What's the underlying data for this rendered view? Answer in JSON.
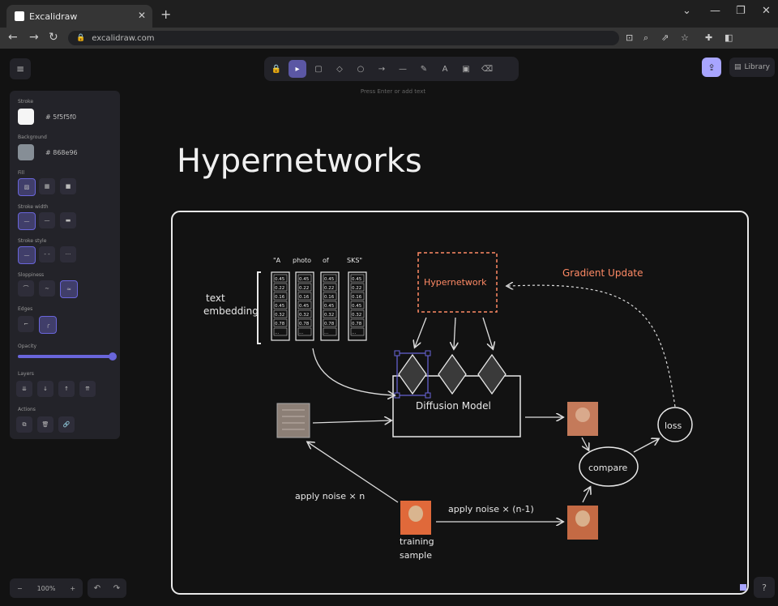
{
  "browser": {
    "tab_title": "Excalidraw",
    "url": "excalidraw.com",
    "new_tab": "+",
    "tab_close": "✕",
    "controls": [
      "⌄",
      "—",
      "❐",
      "✕"
    ],
    "nav": [
      "←",
      "→",
      "↻"
    ]
  },
  "toolbar": {
    "menu_icon": "≡",
    "tools": [
      {
        "name": "lock-icon",
        "glyph": "🔒"
      },
      {
        "name": "selection-icon",
        "glyph": "▸",
        "active": true
      },
      {
        "name": "rectangle-icon",
        "glyph": "▢"
      },
      {
        "name": "diamond-icon",
        "glyph": "◇"
      },
      {
        "name": "ellipse-icon",
        "glyph": "○"
      },
      {
        "name": "arrow-icon",
        "glyph": "→"
      },
      {
        "name": "line-icon",
        "glyph": "—"
      },
      {
        "name": "pencil-icon",
        "glyph": "✎"
      },
      {
        "name": "text-icon",
        "glyph": "A"
      },
      {
        "name": "image-icon",
        "glyph": "▣"
      },
      {
        "name": "eraser-icon",
        "glyph": "⌫"
      }
    ],
    "hint": "Press Enter or add text",
    "share_icon": "⇪",
    "library_label": "Library"
  },
  "properties": {
    "stroke_label": "Stroke",
    "stroke_hex": "5f5f5f0",
    "background_label": "Background",
    "background_hex": "868e96",
    "fill_label": "Fill",
    "stroke_width_label": "Stroke width",
    "stroke_style_label": "Stroke style",
    "sloppiness_label": "Sloppiness",
    "edges_label": "Edges",
    "opacity_label": "Opacity",
    "opacity_value": 100,
    "layers_label": "Layers",
    "actions_label": "Actions",
    "colors": {
      "stroke": "#f5f5f5",
      "background": "#868e96",
      "accent": "#6965db"
    }
  },
  "footer": {
    "zoom_out": "−",
    "zoom_level": "100%",
    "zoom_in": "+",
    "undo": "↶",
    "redo": "↷",
    "help": "?"
  },
  "drawing": {
    "title": "Hypernetworks",
    "prompt_words": [
      "\"A",
      "photo",
      "of",
      "SKS\""
    ],
    "embedding_columns": [
      [
        "0.45",
        "0.22",
        "0.16",
        "0.45",
        "0.32",
        "0.78",
        "..."
      ],
      [
        "0.45",
        "0.22",
        "0.16",
        "0.45",
        "0.32",
        "0.78",
        "..."
      ],
      [
        "0.45",
        "0.22",
        "0.16",
        "0.45",
        "0.32",
        "0.78",
        "..."
      ],
      [
        "0.45",
        "0.22",
        "0.16",
        "0.45",
        "0.32",
        "0.78",
        "..."
      ]
    ],
    "text_embedding_label_1": "text",
    "text_embedding_label_2": "embedding",
    "hypernetwork_label": "Hypernetwork",
    "gradient_label": "Gradient Update",
    "diffusion_label": "Diffusion Model",
    "loss_label": "loss",
    "compare_label": "compare",
    "apply_noise_label": "apply noise × n",
    "apply_noise_n1_label": "apply noise × (n-1)",
    "training_label_1": "training",
    "training_label_2": "sample",
    "colors": {
      "ink": "#e8e8e8",
      "accent": "#ff8a65",
      "selection": "#6965db"
    }
  }
}
